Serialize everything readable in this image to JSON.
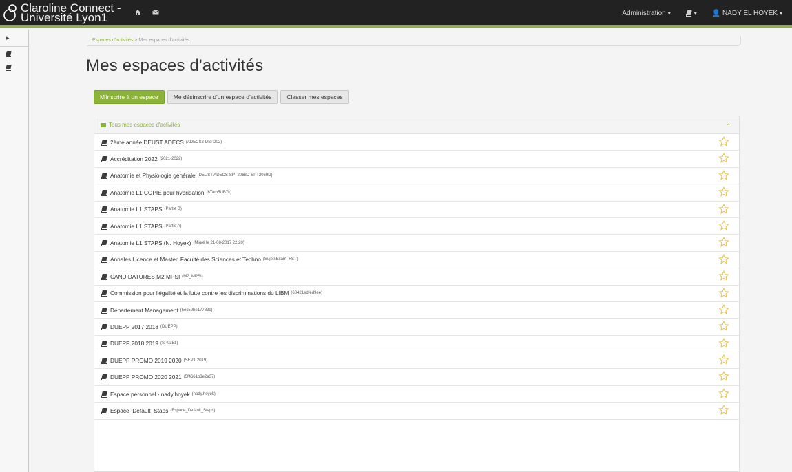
{
  "header": {
    "brand": "Claroline Connect - Université Lyon1",
    "home_icon": "home-icon",
    "mail_icon": "envelope-icon",
    "admin_label": "Administration",
    "user_name": "NADY EL HOYEK",
    "accent": "#8cb339"
  },
  "breadcrumb": {
    "root": "Espaces d'activités",
    "separator": ">",
    "current": "Mes espaces d'activités"
  },
  "page": {
    "title": "Mes espaces d'activités"
  },
  "buttons": {
    "subscribe": "M'inscrire à un espace",
    "unsubscribe": "Me désinscrire d'un espace d'activités",
    "sort": "Classer mes espaces"
  },
  "panel": {
    "title": "Tous mes espaces d'activités",
    "rows": [
      {
        "name": "2ème année DEUST ADECS",
        "code": "(ADECS2-DSP202)"
      },
      {
        "name": "Accréditation 2022",
        "code": "(2021-2022)"
      },
      {
        "name": "Anatomie et Physiologie générale",
        "code": "(DEUST ADECS-SPT2068D-SPT2069D)"
      },
      {
        "name": "Anatomie L1 COPIE pour hybridation",
        "code": "(6Tam5UB7k)"
      },
      {
        "name": "Anatomie L1 STAPS",
        "code": "(Partie B)"
      },
      {
        "name": "Anatomie L1 STAPS",
        "code": "(Partie A)"
      },
      {
        "name": "Anatomie L1 STAPS (N. Hoyek)",
        "code": "(Migré le 21-08-2017 22:20)"
      },
      {
        "name": "Annales Licence et Master, Faculté des Sciences et Techno",
        "code": "(SujetsExam_FST)"
      },
      {
        "name": "CANDIDATURES M2 MPSI",
        "code": "(M2_MPSI)"
      },
      {
        "name": "Commission pour l'égalité et la lutte contre les discriminations du LIBM",
        "code": "(60421edfed9ee)"
      },
      {
        "name": "Département Management",
        "code": "(5ec50be17783c)"
      },
      {
        "name": "DUEPP 2017 2018",
        "code": "(DUEPP)"
      },
      {
        "name": "DUEPP 2018 2019",
        "code": "(SP0351)"
      },
      {
        "name": "DUEPP PROMO 2019 2020",
        "code": "(SEPT 2019)"
      },
      {
        "name": "DUEPP PROMO 2020 2021",
        "code": "(5f4661b3e2a37)"
      },
      {
        "name": "Espace personnel - nady.hoyek",
        "code": "(nady.hoyek)"
      },
      {
        "name": "Espace_Default_Staps",
        "code": "(Espace_Default_Staps)"
      }
    ]
  }
}
